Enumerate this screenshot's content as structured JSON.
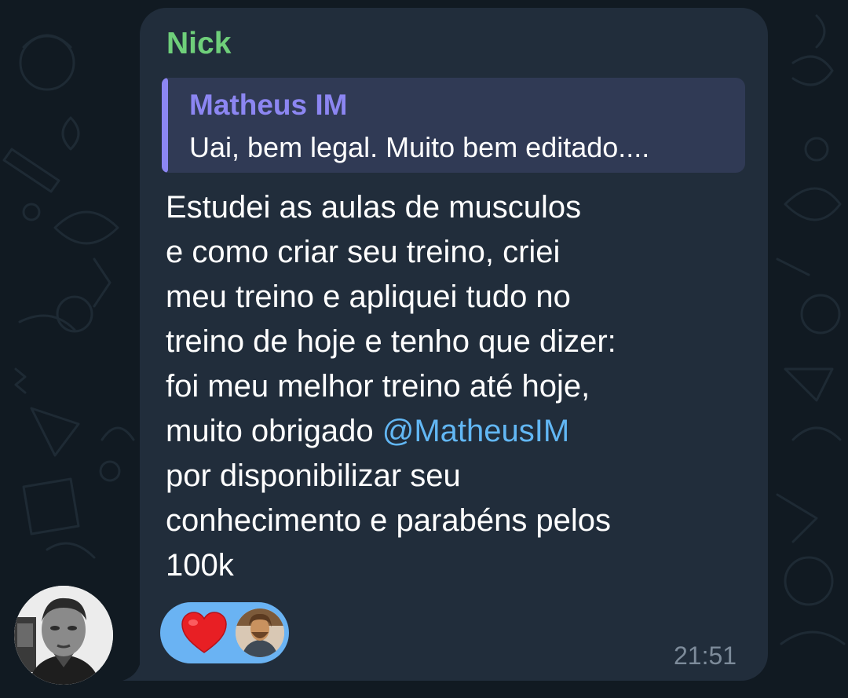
{
  "message": {
    "sender_name": "Nick",
    "reply": {
      "author": "Matheus IM",
      "preview": "Uai, bem legal.  Muito bem editado...."
    },
    "text_lines": [
      "Estudei as aulas de musculos",
      "e como criar seu treino, criei",
      "meu treino e apliquei tudo no",
      "treino de hoje e tenho que dizer:",
      "foi meu melhor treino até hoje,",
      "muito obrigado ",
      "por disponibilizar seu",
      "conhecimento e parabéns pelos",
      "100k"
    ],
    "mention": "@MatheusIM",
    "time": "21:51",
    "reaction": {
      "emoji_icon": "heart-icon",
      "reactor_avatar": "reactor-avatar"
    }
  },
  "colors": {
    "background": "#111a22",
    "bubble": "#212d3b",
    "sender_name": "#6fcf7a",
    "reply_accent": "#8c86f2",
    "reply_background": "#303a55",
    "mention": "#62b7f4",
    "reaction_pill": "#6ab3f3",
    "time": "#7d8b9a"
  }
}
